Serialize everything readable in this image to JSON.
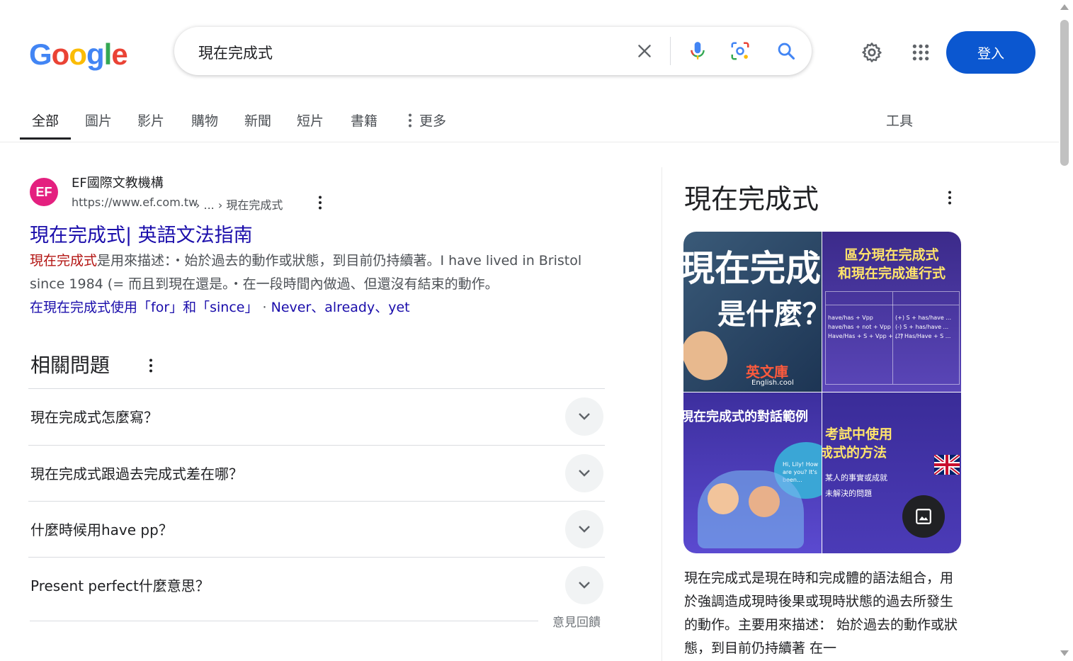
{
  "header": {
    "logo": [
      "G",
      "o",
      "o",
      "g",
      "l",
      "e"
    ],
    "logo_colors": [
      "#4285f4",
      "#ea4335",
      "#fbbc05",
      "#4285f4",
      "#34a853",
      "#ea4335"
    ],
    "search_value": "現在完成式",
    "login_label": "登入"
  },
  "tabs": [
    {
      "label": "全部",
      "active": true
    },
    {
      "label": "圖片"
    },
    {
      "label": "影片"
    },
    {
      "label": "購物"
    },
    {
      "label": "新聞"
    },
    {
      "label": "短片"
    },
    {
      "label": "書籍"
    },
    {
      "label": "更多"
    }
  ],
  "tools_label": "工具",
  "result": {
    "favicon_text": "EF",
    "site_name": "EF國際文教機構",
    "url": "https://www.ef.com.tw",
    "breadcrumb": " › ... › 現在完成式",
    "title": "現在完成式| 英語文法指南",
    "snippet_highlight": "現在完成式",
    "snippet_rest": "是用來描述：・始於過去的動作或狀態，到目前仍持續著。I have lived in Bristol since 1984 (= 而且到現在還是。・在一段時間內做過、但還沒有結束的動作。",
    "link1": "在現在完成式使用「for」和「since」",
    "sep": " · ",
    "link2": "Never、already、yet"
  },
  "related": {
    "heading": "相關問題",
    "questions": [
      "現在完成式怎麼寫？",
      "現在完成式跟過去完成式差在哪？",
      "什麼時候用have pp？",
      "Present perfect什麼意思？"
    ],
    "feedback": "意見回饋"
  },
  "knowledge_panel": {
    "title": "現在完成式",
    "images": [
      {
        "line1": "現在完成",
        "line2": "是什麼？",
        "tag": "英文庫",
        "tag_sub": "English.cool"
      },
      {
        "line1": "區分現在完成式",
        "line2": "和現在完成進行式",
        "cells": [
          "have/has + Vpp",
          "have/has + not + Vpp",
          "Have/Has + S + Vpp + ...?",
          "(+) S + has/have ...",
          "(-) S + has/have ...",
          "(?) Has/Have + S ..."
        ]
      },
      {
        "line1": "現在完成式的對話範例",
        "bubble": "Hi, Lily! How are you? It's been..."
      },
      {
        "line1": "考試中使用",
        "line2": "成式的方法",
        "note1": "某人的事實或成就",
        "note2": "未解決的問題"
      }
    ],
    "description": "現在完成式是現在時和完成體的語法組合，用於強調造成現時後果或現時狀態的過去所發生的動作。主要用來描述： 始於過去的動作或狀態，到目前仍持續著 在一"
  }
}
